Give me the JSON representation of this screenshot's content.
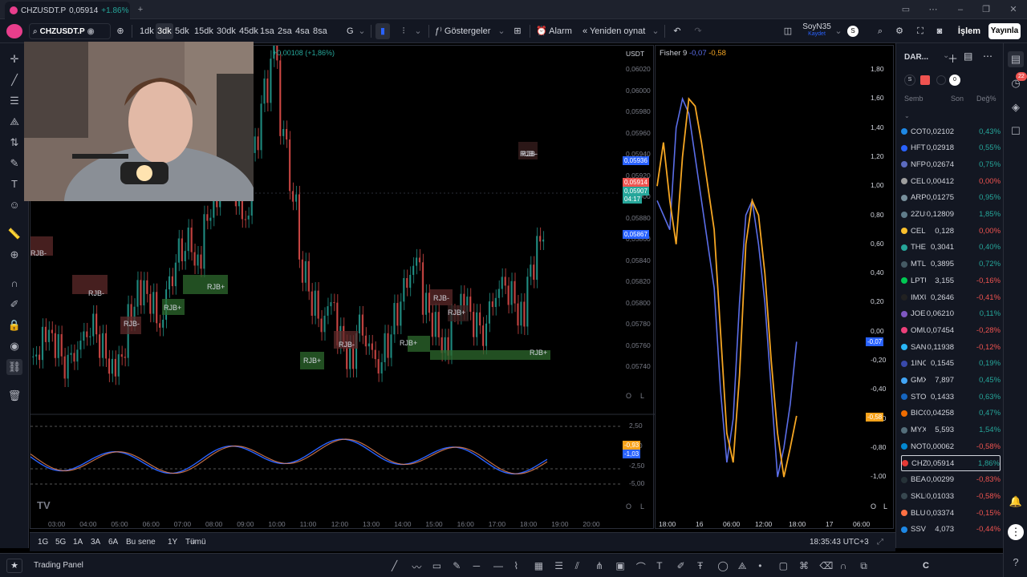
{
  "browser": {
    "tab_title": "CHZUSDT.P",
    "tab_price": "0,05914",
    "tab_change": "+1.86%",
    "new_tab": "+"
  },
  "toolbar": {
    "symbol": "CHZUSDT.P",
    "intervals": [
      "1dk",
      "3dk",
      "5dk",
      "15dk",
      "30dk",
      "45dk",
      "1sa",
      "2sa",
      "4sa",
      "8sa",
      "G"
    ],
    "active_interval": "3dk",
    "indicators_label": "Göstergeler",
    "alarm_label": "Alarm",
    "replay_label": "Yeniden oynat",
    "layout_name": "SoyN35",
    "layout_saved": "Kaydet",
    "layout_badge": "S",
    "trade_label": "İşlem",
    "publish_label": "Yayınla"
  },
  "main_chart": {
    "legend_change": "+0,00108 (+1,86%)",
    "currency": "USDT",
    "price_axis": [
      "0,06020",
      "0,06000",
      "0,05980",
      "0,05960",
      "0,05940",
      "0,05920",
      "0,05900",
      "0,05880",
      "0,05860",
      "0,05840",
      "0,05820",
      "0,05800",
      "0,05780",
      "0,05760",
      "0,05740"
    ],
    "price_tags": {
      "blue_top": "0,05936",
      "red_last": "0,05914",
      "green_last": "0,05907",
      "countdown": "04:17",
      "blue_low": "0,05867"
    },
    "osc_axis": [
      "2,50",
      "0,00",
      "-2,50",
      "-5,00"
    ],
    "osc_tags": {
      "orange": "-0,93",
      "blue": "-1,03"
    },
    "time_axis": [
      "03:00",
      "04:00",
      "05:00",
      "06:00",
      "07:00",
      "08:00",
      "09:00",
      "10:00",
      "11:00",
      "12:00",
      "13:00",
      "14:00",
      "15:00",
      "16:00",
      "17:00",
      "18:00",
      "19:00",
      "20:00"
    ],
    "rjb_labels": [
      "RJB-",
      "RJB-",
      "RJB-",
      "RJB+",
      "RJB+",
      "RJB+",
      "RJB-",
      "RJB+",
      "RJB-",
      "RJB-",
      "RJB+",
      "RJB+",
      "RJB-"
    ],
    "scale_buttons": [
      "O",
      "L"
    ],
    "series_candles": [
      0.0575,
      0.0577,
      0.0576,
      0.0574,
      0.0575,
      0.0577,
      0.0578,
      0.0576,
      0.0574,
      0.0575,
      0.0579,
      0.0581,
      0.058,
      0.0578,
      0.0582,
      0.0585,
      0.0586,
      0.0584,
      0.0588,
      0.059,
      0.0592,
      0.059,
      0.0588,
      0.0595,
      0.06,
      0.0604,
      0.0596,
      0.059,
      0.0583,
      0.058,
      0.0578,
      0.058,
      0.0577,
      0.0575,
      0.0578,
      0.0576,
      0.0574,
      0.0576,
      0.0579,
      0.0582,
      0.0584,
      0.058,
      0.0578,
      0.0576,
      0.0579,
      0.058,
      0.0578,
      0.0577,
      0.058,
      0.0582,
      0.0581,
      0.0579,
      0.0583,
      0.0586,
      0.059,
      0.0593,
      0.0592,
      0.059,
      0.0592,
      0.0591,
      0.059
    ]
  },
  "side_chart": {
    "indicator_name": "Fisher 9",
    "value_blue": "-0,07",
    "value_orange": "-0,58",
    "axis": [
      "1,80",
      "1,60",
      "1,40",
      "1,20",
      "1,00",
      "0,80",
      "0,60",
      "0,40",
      "0,20",
      "0,00",
      "-0,20",
      "-0,40",
      "-0,60",
      "-0,80",
      "-1,00"
    ],
    "tag_blue": "-0,07",
    "tag_orange": "-0,58",
    "time_axis": [
      "18:00",
      "16",
      "06:00",
      "12:00",
      "18:00",
      "17",
      "06:00"
    ],
    "scale_buttons": [
      "O",
      "L"
    ],
    "fisher_blue": [
      0.9,
      0.8,
      0.7,
      1.4,
      1.6,
      1.5,
      1.2,
      0.9,
      0.6,
      0.3,
      -0.4,
      -0.9,
      -0.6,
      0.2,
      0.8,
      0.9,
      0.6,
      0.2,
      -0.4,
      -1.0,
      -0.8,
      -0.5,
      -0.07
    ],
    "fisher_orange": [
      1.0,
      1.3,
      0.9,
      0.6,
      1.2,
      1.6,
      1.55,
      1.3,
      1.0,
      0.7,
      0.0,
      -0.7,
      -0.9,
      -0.3,
      0.6,
      0.9,
      0.8,
      0.4,
      -0.2,
      -0.7,
      -1.0,
      -0.8,
      -0.58
    ]
  },
  "watchlist": {
    "title": "DAR...",
    "filters": [
      "S",
      "0"
    ],
    "headers": [
      "Semb",
      "Son",
      "Değ%"
    ],
    "rows": [
      {
        "sym": "COTI",
        "last": "0,02102",
        "chg": "0,43%",
        "dir": "up",
        "color": "#1e88e5"
      },
      {
        "sym": "HFTI",
        "last": "0,02918",
        "chg": "0,55%",
        "dir": "up",
        "color": "#2962ff"
      },
      {
        "sym": "NFPI",
        "last": "0,02674",
        "chg": "0,75%",
        "dir": "up",
        "color": "#5c6bc0"
      },
      {
        "sym": "CELF",
        "last": "0,00412",
        "chg": "0,00%",
        "dir": "zero",
        "color": "#9e9e9e"
      },
      {
        "sym": "ARPA",
        "last": "0,01275",
        "chg": "0,95%",
        "dir": "up",
        "color": "#78909c"
      },
      {
        "sym": "2ZUS",
        "last": "0,12809",
        "chg": "1,85%",
        "dir": "up",
        "color": "#607d8b"
      },
      {
        "sym": "CELO",
        "last": "0,128",
        "chg": "0,00%",
        "dir": "zero",
        "color": "#fbc02d"
      },
      {
        "sym": "THET",
        "last": "0,3041",
        "chg": "0,40%",
        "dir": "up",
        "color": "#26a69a"
      },
      {
        "sym": "MTLI",
        "last": "0,3895",
        "chg": "0,72%",
        "dir": "up",
        "color": "#455a64"
      },
      {
        "sym": "LPTU",
        "last": "3,155",
        "chg": "-0,16%",
        "dir": "dn",
        "color": "#00c853"
      },
      {
        "sym": "IMXU",
        "last": "0,2646",
        "chg": "-0,41%",
        "dir": "dn",
        "color": "#212121"
      },
      {
        "sym": "JOEU",
        "last": "0,06210",
        "chg": "0,11%",
        "dir": "up",
        "color": "#7e57c2"
      },
      {
        "sym": "OMU",
        "last": "0,07454",
        "chg": "-0,28%",
        "dir": "dn",
        "color": "#ec407a"
      },
      {
        "sym": "SAND",
        "last": "0,11938",
        "chg": "-0,12%",
        "dir": "dn",
        "color": "#29b6f6"
      },
      {
        "sym": "1INC",
        "last": "0,1545",
        "chg": "0,19%",
        "dir": "up",
        "color": "#3949ab"
      },
      {
        "sym": "GMX",
        "last": "7,897",
        "chg": "0,45%",
        "dir": "up",
        "color": "#42a5f5"
      },
      {
        "sym": "STOR",
        "last": "0,1433",
        "chg": "0,63%",
        "dir": "up",
        "color": "#1565c0"
      },
      {
        "sym": "BICO",
        "last": "0,04258",
        "chg": "0,47%",
        "dir": "up",
        "color": "#ef6c00"
      },
      {
        "sym": "MYXI",
        "last": "5,593",
        "chg": "1,54%",
        "dir": "up",
        "color": "#546e7a"
      },
      {
        "sym": "NOTU",
        "last": "0,00062",
        "chg": "-0,58%",
        "dir": "dn",
        "color": "#0288d1"
      },
      {
        "sym": "CHZI",
        "last": "0,05914",
        "chg": "1,86%",
        "dir": "up",
        "color": "#e53935",
        "selected": true
      },
      {
        "sym": "BEAM",
        "last": "0,00299",
        "chg": "-0,83%",
        "dir": "dn",
        "color": "#263238"
      },
      {
        "sym": "SKLL",
        "last": "0,01033",
        "chg": "-0,58%",
        "dir": "dn",
        "color": "#37474f"
      },
      {
        "sym": "BLUR",
        "last": "0,03374",
        "chg": "-0,15%",
        "dir": "dn",
        "color": "#ff7043"
      },
      {
        "sym": "SSVL",
        "last": "4,073",
        "chg": "-0,44%",
        "dir": "dn",
        "color": "#1e88e5"
      }
    ]
  },
  "rangebar": {
    "ranges": [
      "1G",
      "5G",
      "1A",
      "3A",
      "6A",
      "Bu sene",
      "1Y",
      "Tümü"
    ],
    "clock": "18:35:43 UTC+3"
  },
  "panelbar": {
    "label": "Trading Panel"
  },
  "rightbar": {
    "notif_count": "22"
  },
  "colors": {
    "up": "#26a69a",
    "down": "#ef5350",
    "blue": "#2962ff",
    "orange": "#f7a21b",
    "fisher_blue": "#5b6ee8",
    "fisher_orange": "#f5a623"
  }
}
